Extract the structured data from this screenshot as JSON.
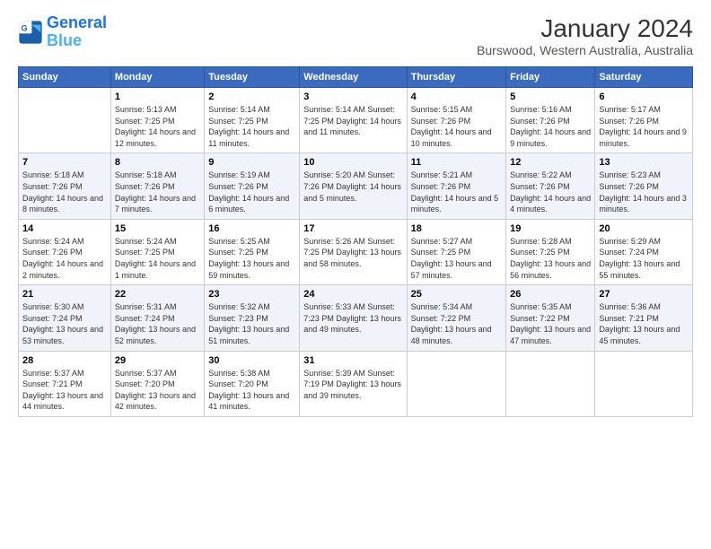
{
  "header": {
    "logo_line1": "General",
    "logo_line2": "Blue",
    "title": "January 2024",
    "subtitle": "Burswood, Western Australia, Australia"
  },
  "days_of_week": [
    "Sunday",
    "Monday",
    "Tuesday",
    "Wednesday",
    "Thursday",
    "Friday",
    "Saturday"
  ],
  "weeks": [
    [
      {
        "day": "",
        "info": ""
      },
      {
        "day": "1",
        "info": "Sunrise: 5:13 AM\nSunset: 7:25 PM\nDaylight: 14 hours\nand 12 minutes."
      },
      {
        "day": "2",
        "info": "Sunrise: 5:14 AM\nSunset: 7:25 PM\nDaylight: 14 hours\nand 11 minutes."
      },
      {
        "day": "3",
        "info": "Sunrise: 5:14 AM\nSunset: 7:25 PM\nDaylight: 14 hours\nand 11 minutes."
      },
      {
        "day": "4",
        "info": "Sunrise: 5:15 AM\nSunset: 7:26 PM\nDaylight: 14 hours\nand 10 minutes."
      },
      {
        "day": "5",
        "info": "Sunrise: 5:16 AM\nSunset: 7:26 PM\nDaylight: 14 hours\nand 9 minutes."
      },
      {
        "day": "6",
        "info": "Sunrise: 5:17 AM\nSunset: 7:26 PM\nDaylight: 14 hours\nand 9 minutes."
      }
    ],
    [
      {
        "day": "7",
        "info": "Sunrise: 5:18 AM\nSunset: 7:26 PM\nDaylight: 14 hours\nand 8 minutes."
      },
      {
        "day": "8",
        "info": "Sunrise: 5:18 AM\nSunset: 7:26 PM\nDaylight: 14 hours\nand 7 minutes."
      },
      {
        "day": "9",
        "info": "Sunrise: 5:19 AM\nSunset: 7:26 PM\nDaylight: 14 hours\nand 6 minutes."
      },
      {
        "day": "10",
        "info": "Sunrise: 5:20 AM\nSunset: 7:26 PM\nDaylight: 14 hours\nand 5 minutes."
      },
      {
        "day": "11",
        "info": "Sunrise: 5:21 AM\nSunset: 7:26 PM\nDaylight: 14 hours\nand 5 minutes."
      },
      {
        "day": "12",
        "info": "Sunrise: 5:22 AM\nSunset: 7:26 PM\nDaylight: 14 hours\nand 4 minutes."
      },
      {
        "day": "13",
        "info": "Sunrise: 5:23 AM\nSunset: 7:26 PM\nDaylight: 14 hours\nand 3 minutes."
      }
    ],
    [
      {
        "day": "14",
        "info": "Sunrise: 5:24 AM\nSunset: 7:26 PM\nDaylight: 14 hours\nand 2 minutes."
      },
      {
        "day": "15",
        "info": "Sunrise: 5:24 AM\nSunset: 7:25 PM\nDaylight: 14 hours\nand 1 minute."
      },
      {
        "day": "16",
        "info": "Sunrise: 5:25 AM\nSunset: 7:25 PM\nDaylight: 13 hours\nand 59 minutes."
      },
      {
        "day": "17",
        "info": "Sunrise: 5:26 AM\nSunset: 7:25 PM\nDaylight: 13 hours\nand 58 minutes."
      },
      {
        "day": "18",
        "info": "Sunrise: 5:27 AM\nSunset: 7:25 PM\nDaylight: 13 hours\nand 57 minutes."
      },
      {
        "day": "19",
        "info": "Sunrise: 5:28 AM\nSunset: 7:25 PM\nDaylight: 13 hours\nand 56 minutes."
      },
      {
        "day": "20",
        "info": "Sunrise: 5:29 AM\nSunset: 7:24 PM\nDaylight: 13 hours\nand 55 minutes."
      }
    ],
    [
      {
        "day": "21",
        "info": "Sunrise: 5:30 AM\nSunset: 7:24 PM\nDaylight: 13 hours\nand 53 minutes."
      },
      {
        "day": "22",
        "info": "Sunrise: 5:31 AM\nSunset: 7:24 PM\nDaylight: 13 hours\nand 52 minutes."
      },
      {
        "day": "23",
        "info": "Sunrise: 5:32 AM\nSunset: 7:23 PM\nDaylight: 13 hours\nand 51 minutes."
      },
      {
        "day": "24",
        "info": "Sunrise: 5:33 AM\nSunset: 7:23 PM\nDaylight: 13 hours\nand 49 minutes."
      },
      {
        "day": "25",
        "info": "Sunrise: 5:34 AM\nSunset: 7:22 PM\nDaylight: 13 hours\nand 48 minutes."
      },
      {
        "day": "26",
        "info": "Sunrise: 5:35 AM\nSunset: 7:22 PM\nDaylight: 13 hours\nand 47 minutes."
      },
      {
        "day": "27",
        "info": "Sunrise: 5:36 AM\nSunset: 7:21 PM\nDaylight: 13 hours\nand 45 minutes."
      }
    ],
    [
      {
        "day": "28",
        "info": "Sunrise: 5:37 AM\nSunset: 7:21 PM\nDaylight: 13 hours\nand 44 minutes."
      },
      {
        "day": "29",
        "info": "Sunrise: 5:37 AM\nSunset: 7:20 PM\nDaylight: 13 hours\nand 42 minutes."
      },
      {
        "day": "30",
        "info": "Sunrise: 5:38 AM\nSunset: 7:20 PM\nDaylight: 13 hours\nand 41 minutes."
      },
      {
        "day": "31",
        "info": "Sunrise: 5:39 AM\nSunset: 7:19 PM\nDaylight: 13 hours\nand 39 minutes."
      },
      {
        "day": "",
        "info": ""
      },
      {
        "day": "",
        "info": ""
      },
      {
        "day": "",
        "info": ""
      }
    ]
  ]
}
